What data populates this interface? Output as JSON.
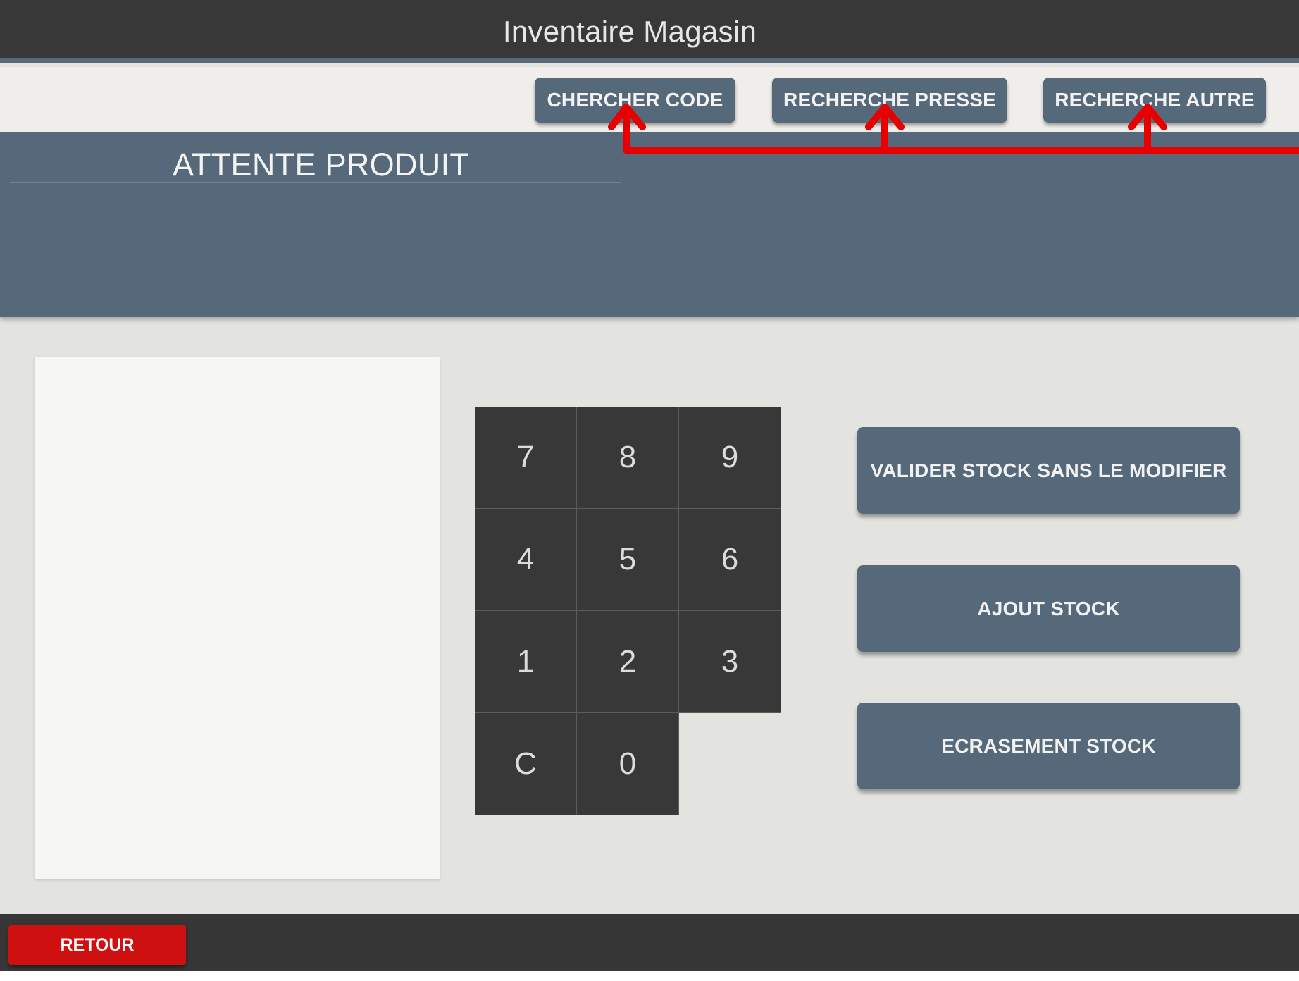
{
  "window": {
    "title": "Inventaire Magasin"
  },
  "toolbar": {
    "search_code_label": "CHERCHER CODE",
    "search_press_label": "RECHERCHE PRESSE",
    "search_other_label": "RECHERCHE AUTRE"
  },
  "product": {
    "status_title": "ATTENTE PRODUIT"
  },
  "annotation": {
    "color": "#e80000"
  },
  "keypad": {
    "keys": [
      "7",
      "8",
      "9",
      "4",
      "5",
      "6",
      "1",
      "2",
      "3",
      "C",
      "0"
    ]
  },
  "actions": {
    "validate_label": "VALIDER STOCK SANS LE MODIFIER",
    "add_label": "AJOUT STOCK",
    "overwrite_label": "ECRASEMENT STOCK"
  },
  "footer": {
    "back_label": "RETOUR"
  },
  "colors": {
    "accent": "#56697a",
    "dark": "#383838",
    "danger": "#cf1010",
    "background": "#e3e3e0"
  }
}
